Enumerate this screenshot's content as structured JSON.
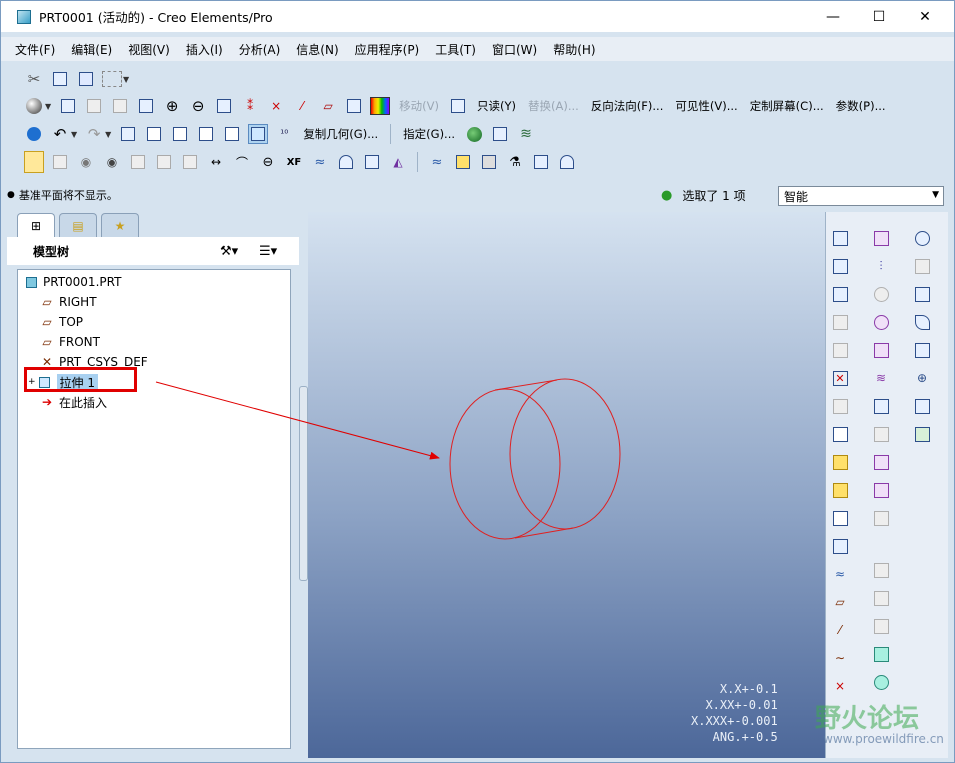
{
  "window": {
    "title": "PRT0001 (活动的) - Creo Elements/Pro",
    "minimize": "—",
    "maximize": "☐",
    "close": "✕"
  },
  "menu": [
    "文件(F)",
    "编辑(E)",
    "视图(V)",
    "插入(I)",
    "分析(A)",
    "信息(N)",
    "应用程序(P)",
    "工具(T)",
    "窗口(W)",
    "帮助(H)"
  ],
  "toolbar_labels": {
    "move": "移动(V)",
    "readonly": "只读(Y)",
    "replace": "替换(A)...",
    "flip": "反向法向(F)...",
    "visibility": "可见性(V)...",
    "custom_screen": "定制屏幕(C)...",
    "params": "参数(P)...",
    "copy_geom": "复制几何(G)...",
    "assign": "指定(G)..."
  },
  "status": {
    "message": "基准平面将不显示。",
    "selection": "选取了 1 项",
    "filter": "智能"
  },
  "model_tree": {
    "title": "模型树",
    "items": [
      "PRT0001.PRT",
      "RIGHT",
      "TOP",
      "FRONT",
      "PRT_CSYS_DEF",
      "拉伸 1",
      "在此插入"
    ]
  },
  "tolerances": [
    "X.X+-0.1",
    "X.XX+-0.01",
    "X.XXX+-0.001",
    "ANG.+-0.5"
  ],
  "watermark": {
    "title": "野火论坛",
    "url": "www.proewildfire.cn"
  },
  "colors": {
    "highlight": "#e00000",
    "edge": "#e02020",
    "selected_bg": "#a8d0f0"
  }
}
